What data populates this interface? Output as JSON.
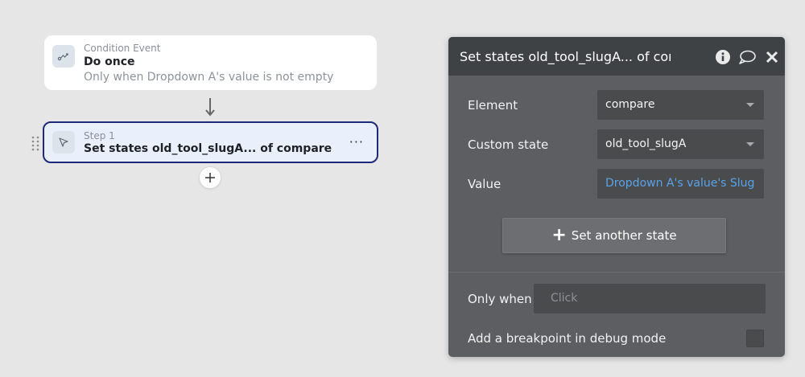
{
  "canvas": {
    "event": {
      "kind": "Condition Event",
      "title": "Do once",
      "condition": "Only when Dropdown A's value is not empty",
      "icon": "condition-event-icon"
    },
    "step": {
      "kind": "Step 1",
      "title": "Set states old_tool_slugA... of compare",
      "icon": "cursor-icon",
      "more": "···"
    },
    "add_step_icon": "plus-icon",
    "connector_icon": "arrow-down-icon"
  },
  "panel": {
    "title": "Set states old_tool_slugA... of compare",
    "header_icons": [
      "info-icon",
      "comment-icon",
      "close-icon"
    ],
    "element": {
      "label": "Element",
      "value": "compare"
    },
    "custom_state": {
      "label": "Custom state",
      "value": "old_tool_slugA"
    },
    "value": {
      "label": "Value",
      "expression": "Dropdown A's value's Slug"
    },
    "set_another": {
      "plus": "+",
      "label": "Set another state"
    },
    "only_when": {
      "label": "Only when",
      "placeholder": "Click"
    },
    "breakpoint": {
      "label": "Add a breakpoint in debug mode",
      "checked": false
    }
  },
  "colors": {
    "background": "#e6e6e6",
    "panel": "#5c5e61",
    "panel_header": "#3f4244",
    "field": "#494b4d",
    "expression": "#5aa2ea",
    "selected_border": "#1d2a7a"
  }
}
